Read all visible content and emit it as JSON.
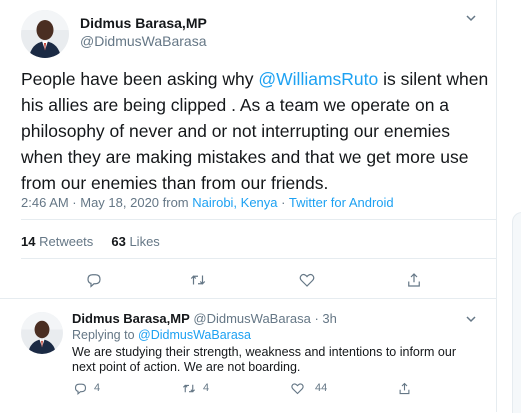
{
  "tweet": {
    "author_name": "Didmus Barasa,MP",
    "author_handle": "@DidmusWaBarasa",
    "text_before": "People have been asking why ",
    "mention": "@WilliamsRuto",
    "text_after": " is silent when his allies are being clipped . As a team we operate on a philosophy of never and or not  interrupting our enemies when they are making mistakes and that we get more use from our enemies than from our friends.",
    "time": "2:46 AM · May 18, 2020 from ",
    "location": "Nairobi, Kenya",
    "separator": " · ",
    "source": "Twitter for Android",
    "retweets_count": "14",
    "retweets_label": "Retweets",
    "likes_count": "63",
    "likes_label": "Likes"
  },
  "reply": {
    "author_name": "Didmus Barasa,MP",
    "author_handle": "@DidmusWaBarasa · 3h",
    "replying_label": "Replying to ",
    "replying_to": "@DidmusWaBarasa",
    "text": "We are studying their strength, weakness and intentions to inform our next point of action. We are not boarding.",
    "reply_count": "4",
    "retweet_count": "4",
    "like_count": "44"
  },
  "icons": {
    "caret": "chevron-down-icon",
    "reply": "reply-icon",
    "retweet": "retweet-icon",
    "like": "heart-icon",
    "share": "share-icon"
  },
  "colors": {
    "link": "#1da1f2",
    "secondary_text": "#657786",
    "primary_text": "#14171a",
    "divider": "#e6ecf0"
  }
}
